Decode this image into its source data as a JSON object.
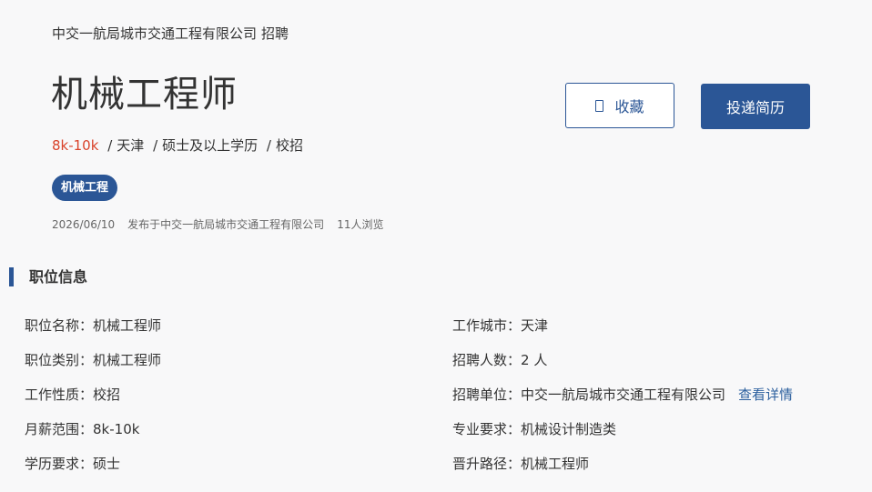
{
  "header": {
    "company": "中交一航局城市交通工程有限公司",
    "recruit_suffix": "招聘"
  },
  "job": {
    "title": "机械工程师",
    "salary": "8k-10k",
    "separator": "/",
    "city": "天津",
    "education": "硕士及以上学历",
    "type": "校招",
    "tag": "机械工程",
    "date": "2026/06/10",
    "published_by": "发布于中交一航局城市交通工程有限公司",
    "views": "11人浏览"
  },
  "actions": {
    "favorite_label": "收藏",
    "apply_label": "投递简历"
  },
  "section": {
    "title": "职位信息"
  },
  "info_left": [
    {
      "label": "职位名称：",
      "value": "机械工程师"
    },
    {
      "label": "职位类别：",
      "value": "机械工程师"
    },
    {
      "label": "工作性质：",
      "value": "校招"
    },
    {
      "label": "月薪范围：",
      "value": "8k-10k"
    },
    {
      "label": "学历要求：",
      "value": "硕士"
    }
  ],
  "info_right": [
    {
      "label": "工作城市：",
      "value": "天津"
    },
    {
      "label": "招聘人数：",
      "value": "2 人"
    },
    {
      "label": "招聘单位：",
      "value": "中交一航局城市交通工程有限公司",
      "link": "查看详情"
    },
    {
      "label": "专业要求：",
      "value": "机械设计制造类"
    },
    {
      "label": "晋升路径：",
      "value": "机械工程师"
    }
  ],
  "colors": {
    "brand": "#2b5696",
    "salary": "#d9432b",
    "link": "#2b5f9e",
    "background": "#f8f8f9"
  }
}
